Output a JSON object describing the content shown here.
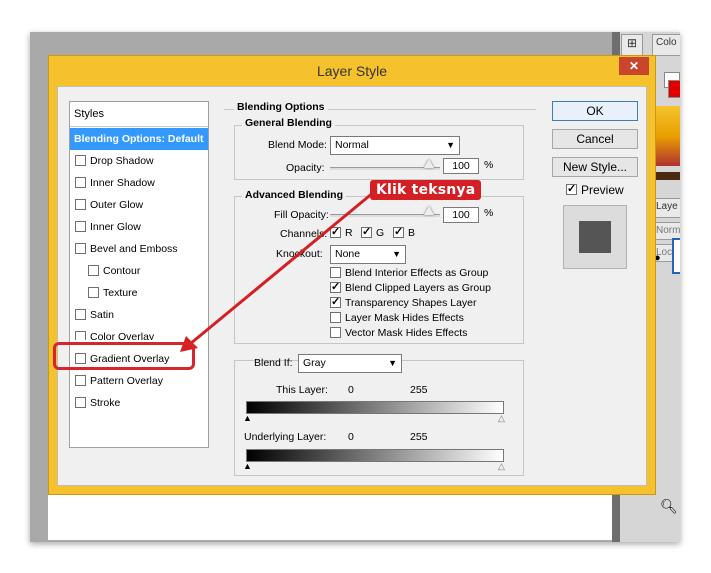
{
  "app": {
    "window_title": "Layer Style",
    "close_symbol": "✕"
  },
  "background_panel": {
    "tab_top": "Colo",
    "tab_layers": "Laye",
    "tab_normal": "Norm",
    "tab_lock": "Lock",
    "tab_arrange": "⊞"
  },
  "styles_list": {
    "header": "Styles",
    "selected": "Blending Options: Default",
    "items": [
      {
        "label": "Drop Shadow",
        "checked": false,
        "indent": false
      },
      {
        "label": "Inner Shadow",
        "checked": false,
        "indent": false
      },
      {
        "label": "Outer Glow",
        "checked": false,
        "indent": false
      },
      {
        "label": "Inner Glow",
        "checked": false,
        "indent": false
      },
      {
        "label": "Bevel and Emboss",
        "checked": false,
        "indent": false
      },
      {
        "label": "Contour",
        "checked": false,
        "indent": true
      },
      {
        "label": "Texture",
        "checked": false,
        "indent": true
      },
      {
        "label": "Satin",
        "checked": false,
        "indent": false
      },
      {
        "label": "Color Overlay",
        "checked": false,
        "indent": false
      },
      {
        "label": "Gradient Overlay",
        "checked": false,
        "indent": false
      },
      {
        "label": "Pattern Overlay",
        "checked": false,
        "indent": false
      },
      {
        "label": "Stroke",
        "checked": false,
        "indent": false
      }
    ]
  },
  "blending": {
    "title": "Blending Options",
    "general": {
      "title": "General Blending",
      "blend_mode_label": "Blend Mode:",
      "blend_mode_value": "Normal",
      "opacity_label": "Opacity:",
      "opacity_value": "100",
      "percent": "%"
    },
    "advanced": {
      "title": "Advanced Blending",
      "fill_opacity_label": "Fill Opacity:",
      "fill_opacity_value": "100",
      "percent": "%",
      "channels_label": "Channels:",
      "channels": [
        {
          "label": "R",
          "checked": true
        },
        {
          "label": "G",
          "checked": true
        },
        {
          "label": "B",
          "checked": true
        }
      ],
      "knockout_label": "Knockout:",
      "knockout_value": "None",
      "options": [
        {
          "label": "Blend Interior Effects as Group",
          "checked": false
        },
        {
          "label": "Blend Clipped Layers as Group",
          "checked": true
        },
        {
          "label": "Transparency Shapes Layer",
          "checked": true
        },
        {
          "label": "Layer Mask Hides Effects",
          "checked": false
        },
        {
          "label": "Vector Mask Hides Effects",
          "checked": false
        }
      ]
    },
    "blend_if": {
      "label": "Blend If:",
      "value": "Gray",
      "this_layer_label": "This Layer:",
      "this_layer_min": "0",
      "this_layer_max": "255",
      "underlying_label": "Underlying Layer:",
      "underlying_min": "0",
      "underlying_max": "255"
    }
  },
  "buttons": {
    "ok": "OK",
    "cancel": "Cancel",
    "new_style": "New Style...",
    "preview_label": "Preview",
    "preview_checked": true
  },
  "annotation": {
    "callout_text": "Klik teksnya",
    "color": "#d41f24"
  }
}
